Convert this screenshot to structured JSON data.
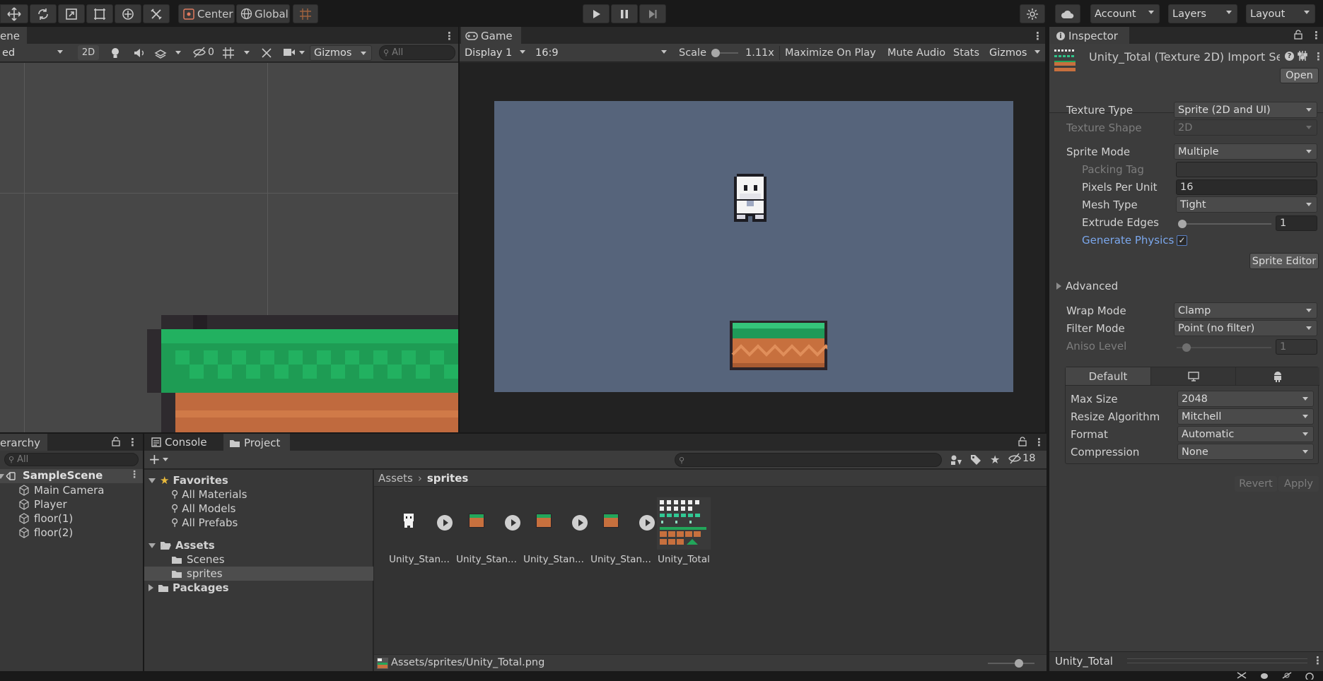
{
  "toolbar": {
    "center_label": "Center",
    "global_label": "Global",
    "account_label": "Account",
    "layers_label": "Layers",
    "layout_label": "Layout"
  },
  "scene": {
    "tab_label": "ene",
    "mode_label": "ed",
    "btn_2d": "2D",
    "hidden_count": "0",
    "gizmos_label": "Gizmos",
    "search_placeholder": "All"
  },
  "game": {
    "tab_label": "Game",
    "display_label": "Display 1",
    "aspect_label": "16:9",
    "scale_label": "Scale",
    "scale_value": "1.11x",
    "maximize_label": "Maximize On Play",
    "mute_label": "Mute Audio",
    "stats_label": "Stats",
    "gizmos_label": "Gizmos"
  },
  "hierarchy": {
    "tab_label": "erarchy",
    "search_placeholder": "All",
    "scene_name": "SampleScene",
    "items": [
      "Main Camera",
      "Player",
      "floor(1)",
      "floor(2)"
    ]
  },
  "project": {
    "console_tab": "Console",
    "project_tab": "Project",
    "hidden_count": "18",
    "favorites_label": "Favorites",
    "favorites": [
      "All Materials",
      "All Models",
      "All Prefabs"
    ],
    "assets_label": "Assets",
    "asset_folders": [
      "Scenes",
      "sprites"
    ],
    "packages_label": "Packages",
    "breadcrumb_root": "Assets",
    "breadcrumb_current": "sprites",
    "assets": [
      "Unity_Stan...",
      "Unity_Stan...",
      "Unity_Stan...",
      "Unity_Stan...",
      "Unity_Total"
    ],
    "footer_path": "Assets/sprites/Unity_Total.png"
  },
  "inspector": {
    "tab_label": "Inspector",
    "title": "Unity_Total (Texture 2D) Import Se",
    "open_label": "Open",
    "texture_type_label": "Texture Type",
    "texture_type_value": "Sprite (2D and UI)",
    "texture_shape_label": "Texture Shape",
    "texture_shape_value": "2D",
    "sprite_mode_label": "Sprite Mode",
    "sprite_mode_value": "Multiple",
    "packing_tag_label": "Packing Tag",
    "packing_tag_value": "",
    "ppu_label": "Pixels Per Unit",
    "ppu_value": "16",
    "mesh_type_label": "Mesh Type",
    "mesh_type_value": "Tight",
    "extrude_label": "Extrude Edges",
    "extrude_value": "1",
    "gen_physics_label": "Generate Physics",
    "sprite_editor_label": "Sprite Editor",
    "advanced_label": "Advanced",
    "wrap_mode_label": "Wrap Mode",
    "wrap_mode_value": "Clamp",
    "filter_mode_label": "Filter Mode",
    "filter_mode_value": "Point (no filter)",
    "aniso_label": "Aniso Level",
    "aniso_value": "1",
    "platform_default_label": "Default",
    "max_size_label": "Max Size",
    "max_size_value": "2048",
    "resize_label": "Resize Algorithm",
    "resize_value": "Mitchell",
    "format_label": "Format",
    "format_value": "Automatic",
    "compression_label": "Compression",
    "compression_value": "None",
    "revert_label": "Revert",
    "apply_label": "Apply",
    "preview_label": "Unity_Total"
  },
  "colors": {
    "accent": "#4c7dd6",
    "link": "#7ba7ec",
    "game_bg": "#56647b",
    "grass": "#22a65a",
    "dirt": "#c77142"
  }
}
